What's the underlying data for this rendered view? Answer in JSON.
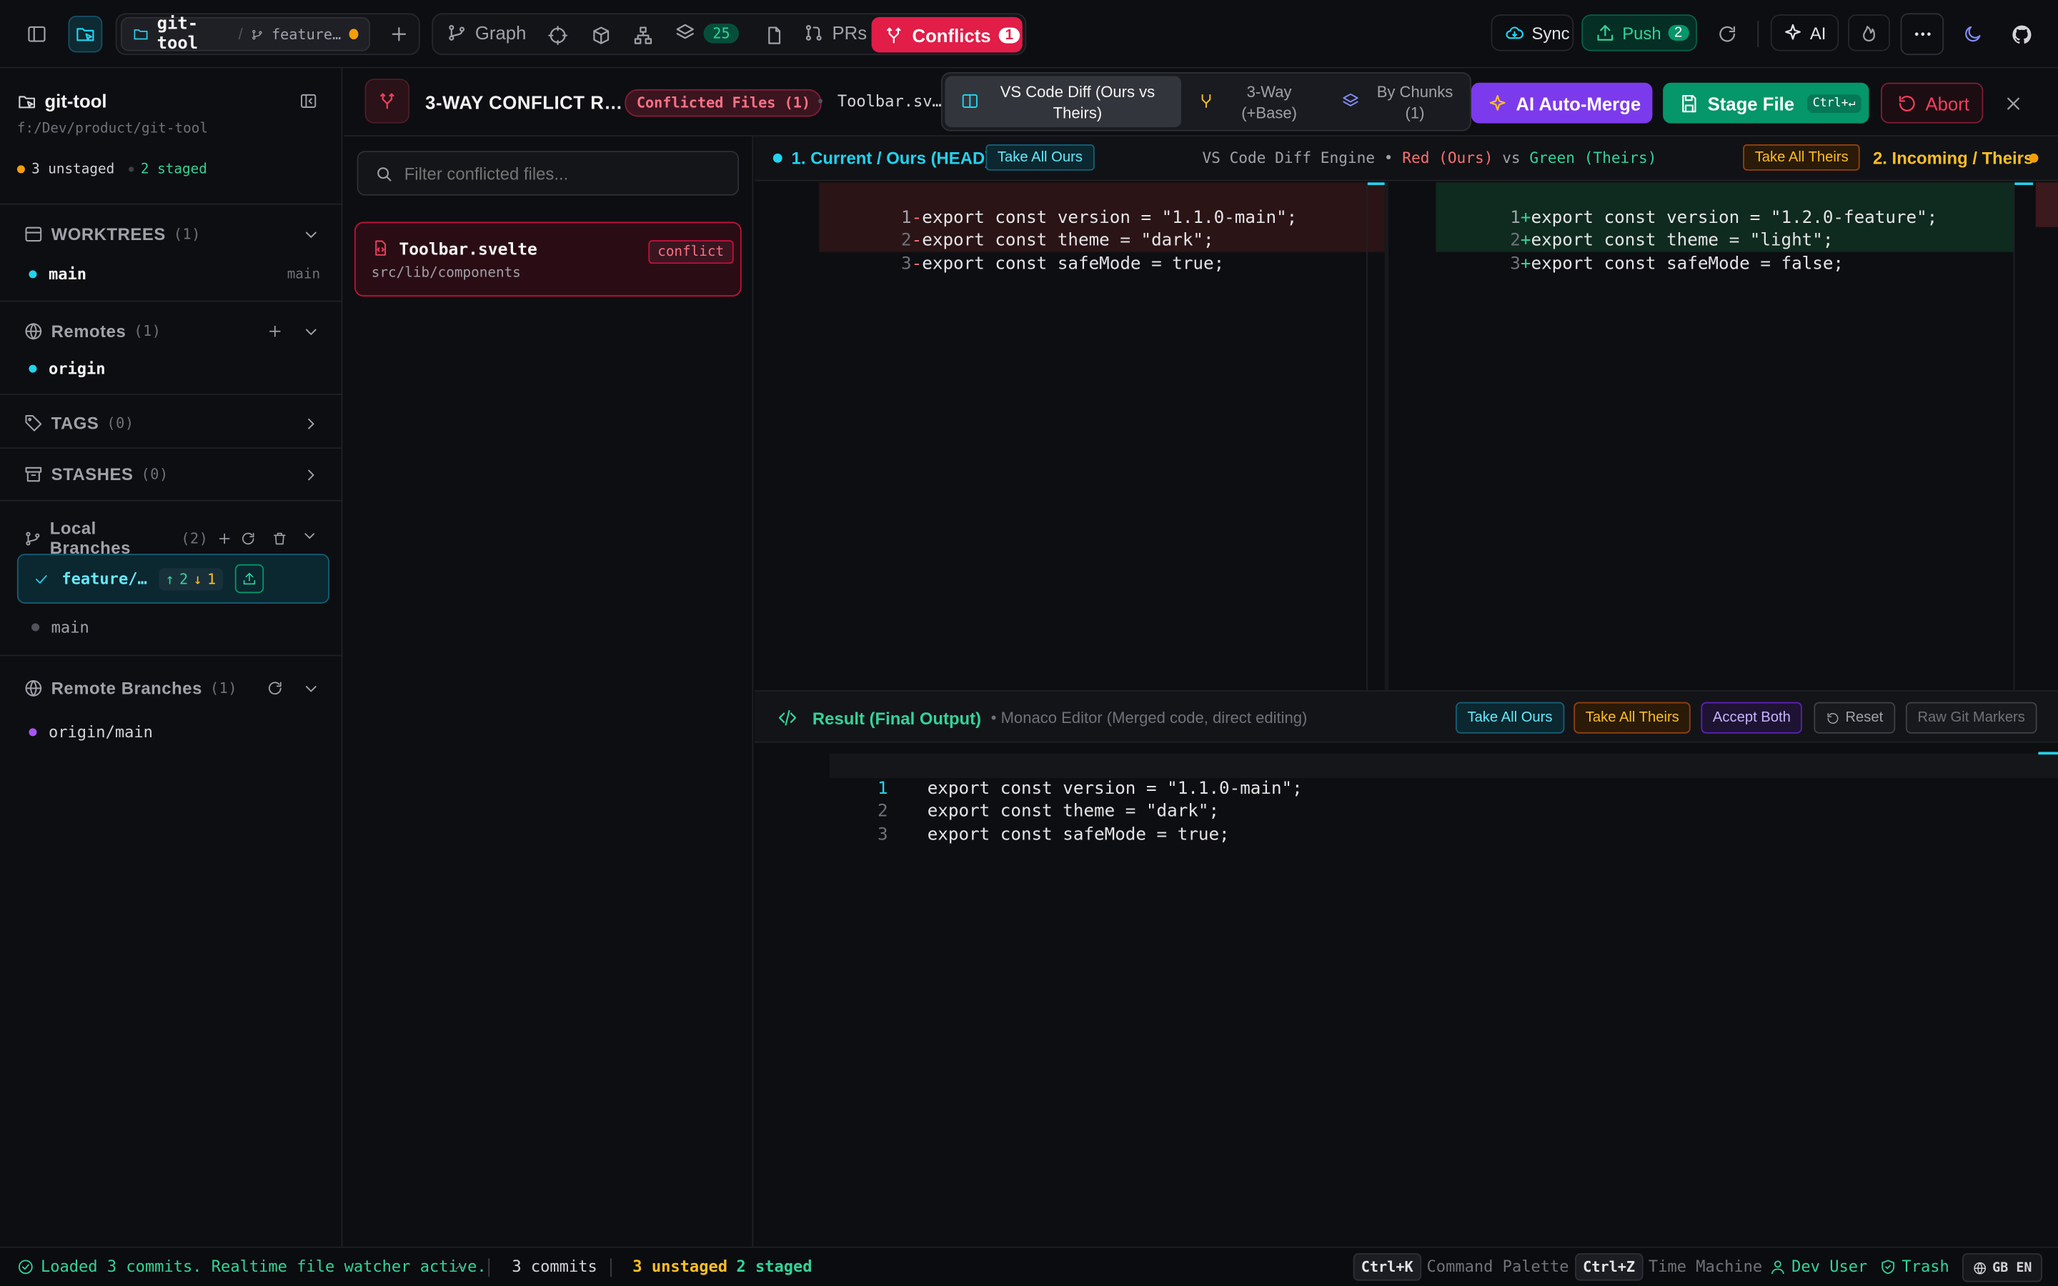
{
  "topbar": {
    "repo_name": "git-tool",
    "branch_short": "feature…",
    "graph_label": "Graph",
    "stack_count": "25",
    "prs_label": "PRs",
    "conflicts_label": "Conflicts",
    "conflicts_count": "1",
    "sync_label": "Sync",
    "push_label": "Push",
    "push_count": "2",
    "ai_label": "AI"
  },
  "sidebar": {
    "repo_name": "git-tool",
    "repo_path": "f:/Dev/product/git-tool",
    "unstaged": "3 unstaged",
    "staged": "2 staged",
    "worktrees": {
      "title": "WORKTREES",
      "count": "(1)",
      "item_name": "main",
      "item_branch": "main"
    },
    "remotes": {
      "title": "Remotes",
      "count": "(1)",
      "item": "origin"
    },
    "tags": {
      "title": "TAGS",
      "count": "(0)"
    },
    "stashes": {
      "title": "STASHES",
      "count": "(0)"
    },
    "local_branches": {
      "title": "Local Branches",
      "count": "(2)",
      "active": "feature/…",
      "ahead": "2",
      "behind": "1",
      "other": "main"
    },
    "remote_branches": {
      "title": "Remote Branches",
      "count": "(1)",
      "item": "origin/main"
    }
  },
  "conflict": {
    "title": "3-WAY CONFLICT R…",
    "files_badge": "Conflicted Files (1)",
    "current_file": "Toolbar.sv…",
    "tabs": [
      {
        "label": "VS Code Diff (Ours vs Theirs)"
      },
      {
        "label": "3-Way (+Base)"
      },
      {
        "label": "By Chunks (1)"
      }
    ],
    "ai_merge_label": "AI Auto-Merge",
    "stage_label": "Stage File",
    "stage_shortcut": "Ctrl+↵",
    "abort_label": "Abort",
    "filter_placeholder": "Filter conflicted files...",
    "file": {
      "name": "Toolbar.svelte",
      "path": "src/lib/components",
      "badge": "conflict"
    }
  },
  "diff": {
    "ours_label": "1. Current / Ours (HEAD)",
    "take_all_ours": "Take All Ours",
    "engine_prefix": "VS Code Diff Engine •",
    "engine_red": "Red (Ours)",
    "engine_vs": "vs",
    "engine_green": "Green (Theirs)",
    "take_all_theirs": "Take All Theirs",
    "theirs_label": "2. Incoming / Theirs",
    "ours_lines": [
      {
        "num": "1",
        "text": "export const version = \"1.1.0-main\";"
      },
      {
        "num": "2",
        "text": "export const theme = \"dark\";"
      },
      {
        "num": "3",
        "text": "export const safeMode = true;"
      }
    ],
    "theirs_lines": [
      {
        "num": "1",
        "text": "export const version = \"1.2.0-feature\";"
      },
      {
        "num": "2",
        "text": "export const theme = \"light\";"
      },
      {
        "num": "3",
        "text": "export const safeMode = false;"
      }
    ]
  },
  "result": {
    "title": "Result (Final Output)",
    "subtitle": "• Monaco Editor (Merged code, direct editing)",
    "take_all_ours": "Take All Ours",
    "take_all_theirs": "Take All Theirs",
    "accept_both": "Accept Both",
    "reset": "Reset",
    "raw_markers": "Raw Git Markers",
    "lines": [
      {
        "num": "1",
        "text": "export const version = \"1.1.0-main\";"
      },
      {
        "num": "2",
        "text": "export const theme = \"dark\";"
      },
      {
        "num": "3",
        "text": "export const safeMode = true;"
      }
    ]
  },
  "statusbar": {
    "message": "Loaded 3 commits. Realtime file watcher active.",
    "commits": "3 commits",
    "unstaged": "3 unstaged",
    "staged": "2 staged",
    "palette_key": "Ctrl+K",
    "palette_label": "Command Palette",
    "time_key": "Ctrl+Z",
    "time_label": "Time Machine",
    "user": "Dev User",
    "trash": "Trash",
    "locale": "GB EN"
  },
  "colors": {
    "accent_cyan": "#22d3ee",
    "conflict_red": "#e11d48",
    "stage_green": "#059669",
    "ai_purple": "#7c3aed",
    "theirs_orange": "#f59e0b"
  }
}
